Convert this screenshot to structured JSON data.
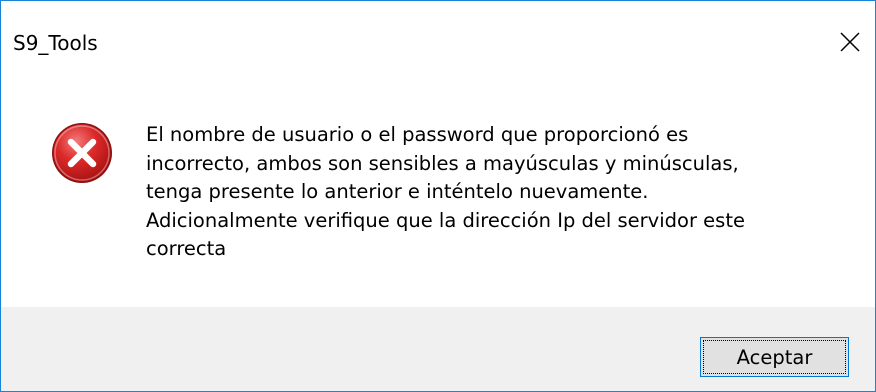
{
  "window": {
    "title": "S9_Tools",
    "close_icon": "close-icon"
  },
  "message": {
    "icon": "error-icon",
    "text": "El nombre de usuario o el password que proporcionó es\nincorrecto, ambos son sensibles a mayúsculas y minúsculas,\ntenga presente lo anterior e inténtelo nuevamente.\nAdicionalmente verifique que la dirección Ip del servidor este\ncorrecta"
  },
  "buttons": {
    "ok_label": "Aceptar"
  },
  "colors": {
    "border": "#1883d7",
    "footer_background": "#f0f0f0",
    "button_border": "#0078d7",
    "error_red": "#d9232d"
  }
}
